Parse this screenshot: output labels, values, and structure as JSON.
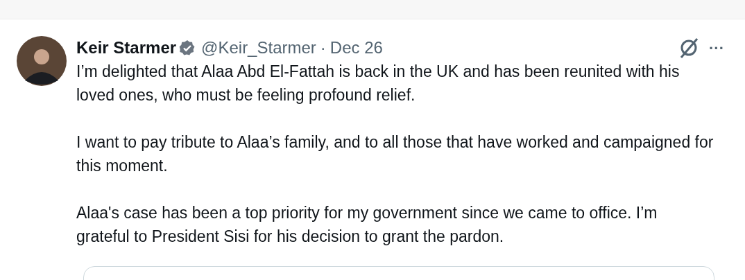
{
  "tweet": {
    "author": {
      "name": "Keir Starmer",
      "verified": true,
      "handle": "@Keir_Starmer",
      "separator": "·",
      "date": "Dec 26"
    },
    "paragraphs": [
      "I’m delighted that Alaa Abd El-Fattah is back in the UK and has been reunited with his loved ones, who must be feeling profound relief.",
      "I want to pay tribute to Alaa’s family, and to all those that have worked and campaigned for this moment.",
      "Alaa's case has been a top priority for my government since we came to office. I’m grateful to President Sisi for his decision to grant the pardon."
    ],
    "more": "···"
  }
}
